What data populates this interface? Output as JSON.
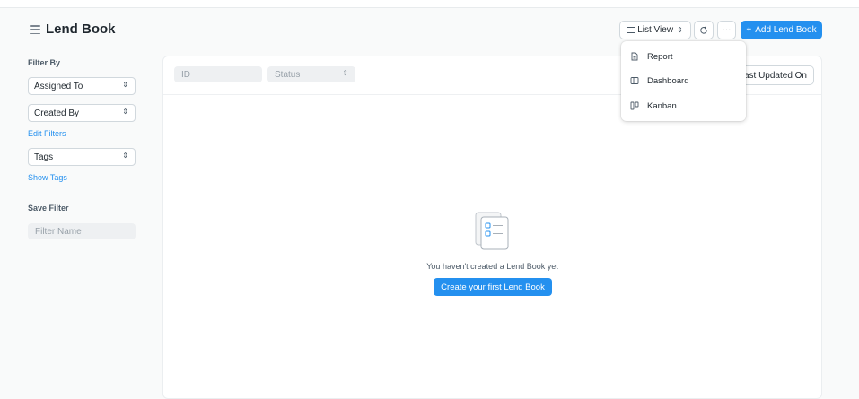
{
  "header": {
    "title": "Lend Book",
    "view_selector_label": "List View",
    "more_label": "···",
    "add_button_label": "Add Lend Book"
  },
  "sidebar": {
    "filter_by_label": "Filter By",
    "filters": [
      "Assigned To",
      "Created By"
    ],
    "edit_filters_label": "Edit Filters",
    "tags_label": "Tags",
    "show_tags_label": "Show Tags",
    "save_filter_label": "Save Filter",
    "filter_name_placeholder": "Filter Name"
  },
  "list": {
    "id_placeholder": "ID",
    "status_placeholder": "Status",
    "sort_label": "Last Updated On",
    "empty_message": "You haven't created a Lend Book yet",
    "create_first_label": "Create your first Lend Book"
  },
  "view_menu": {
    "items": [
      {
        "label": "Report",
        "icon": "report-icon"
      },
      {
        "label": "Dashboard",
        "icon": "dashboard-icon"
      },
      {
        "label": "Kanban",
        "icon": "kanban-icon"
      }
    ]
  },
  "colors": {
    "primary": "#2490ef",
    "background": "#f9fafa",
    "text": "#1f272e"
  }
}
